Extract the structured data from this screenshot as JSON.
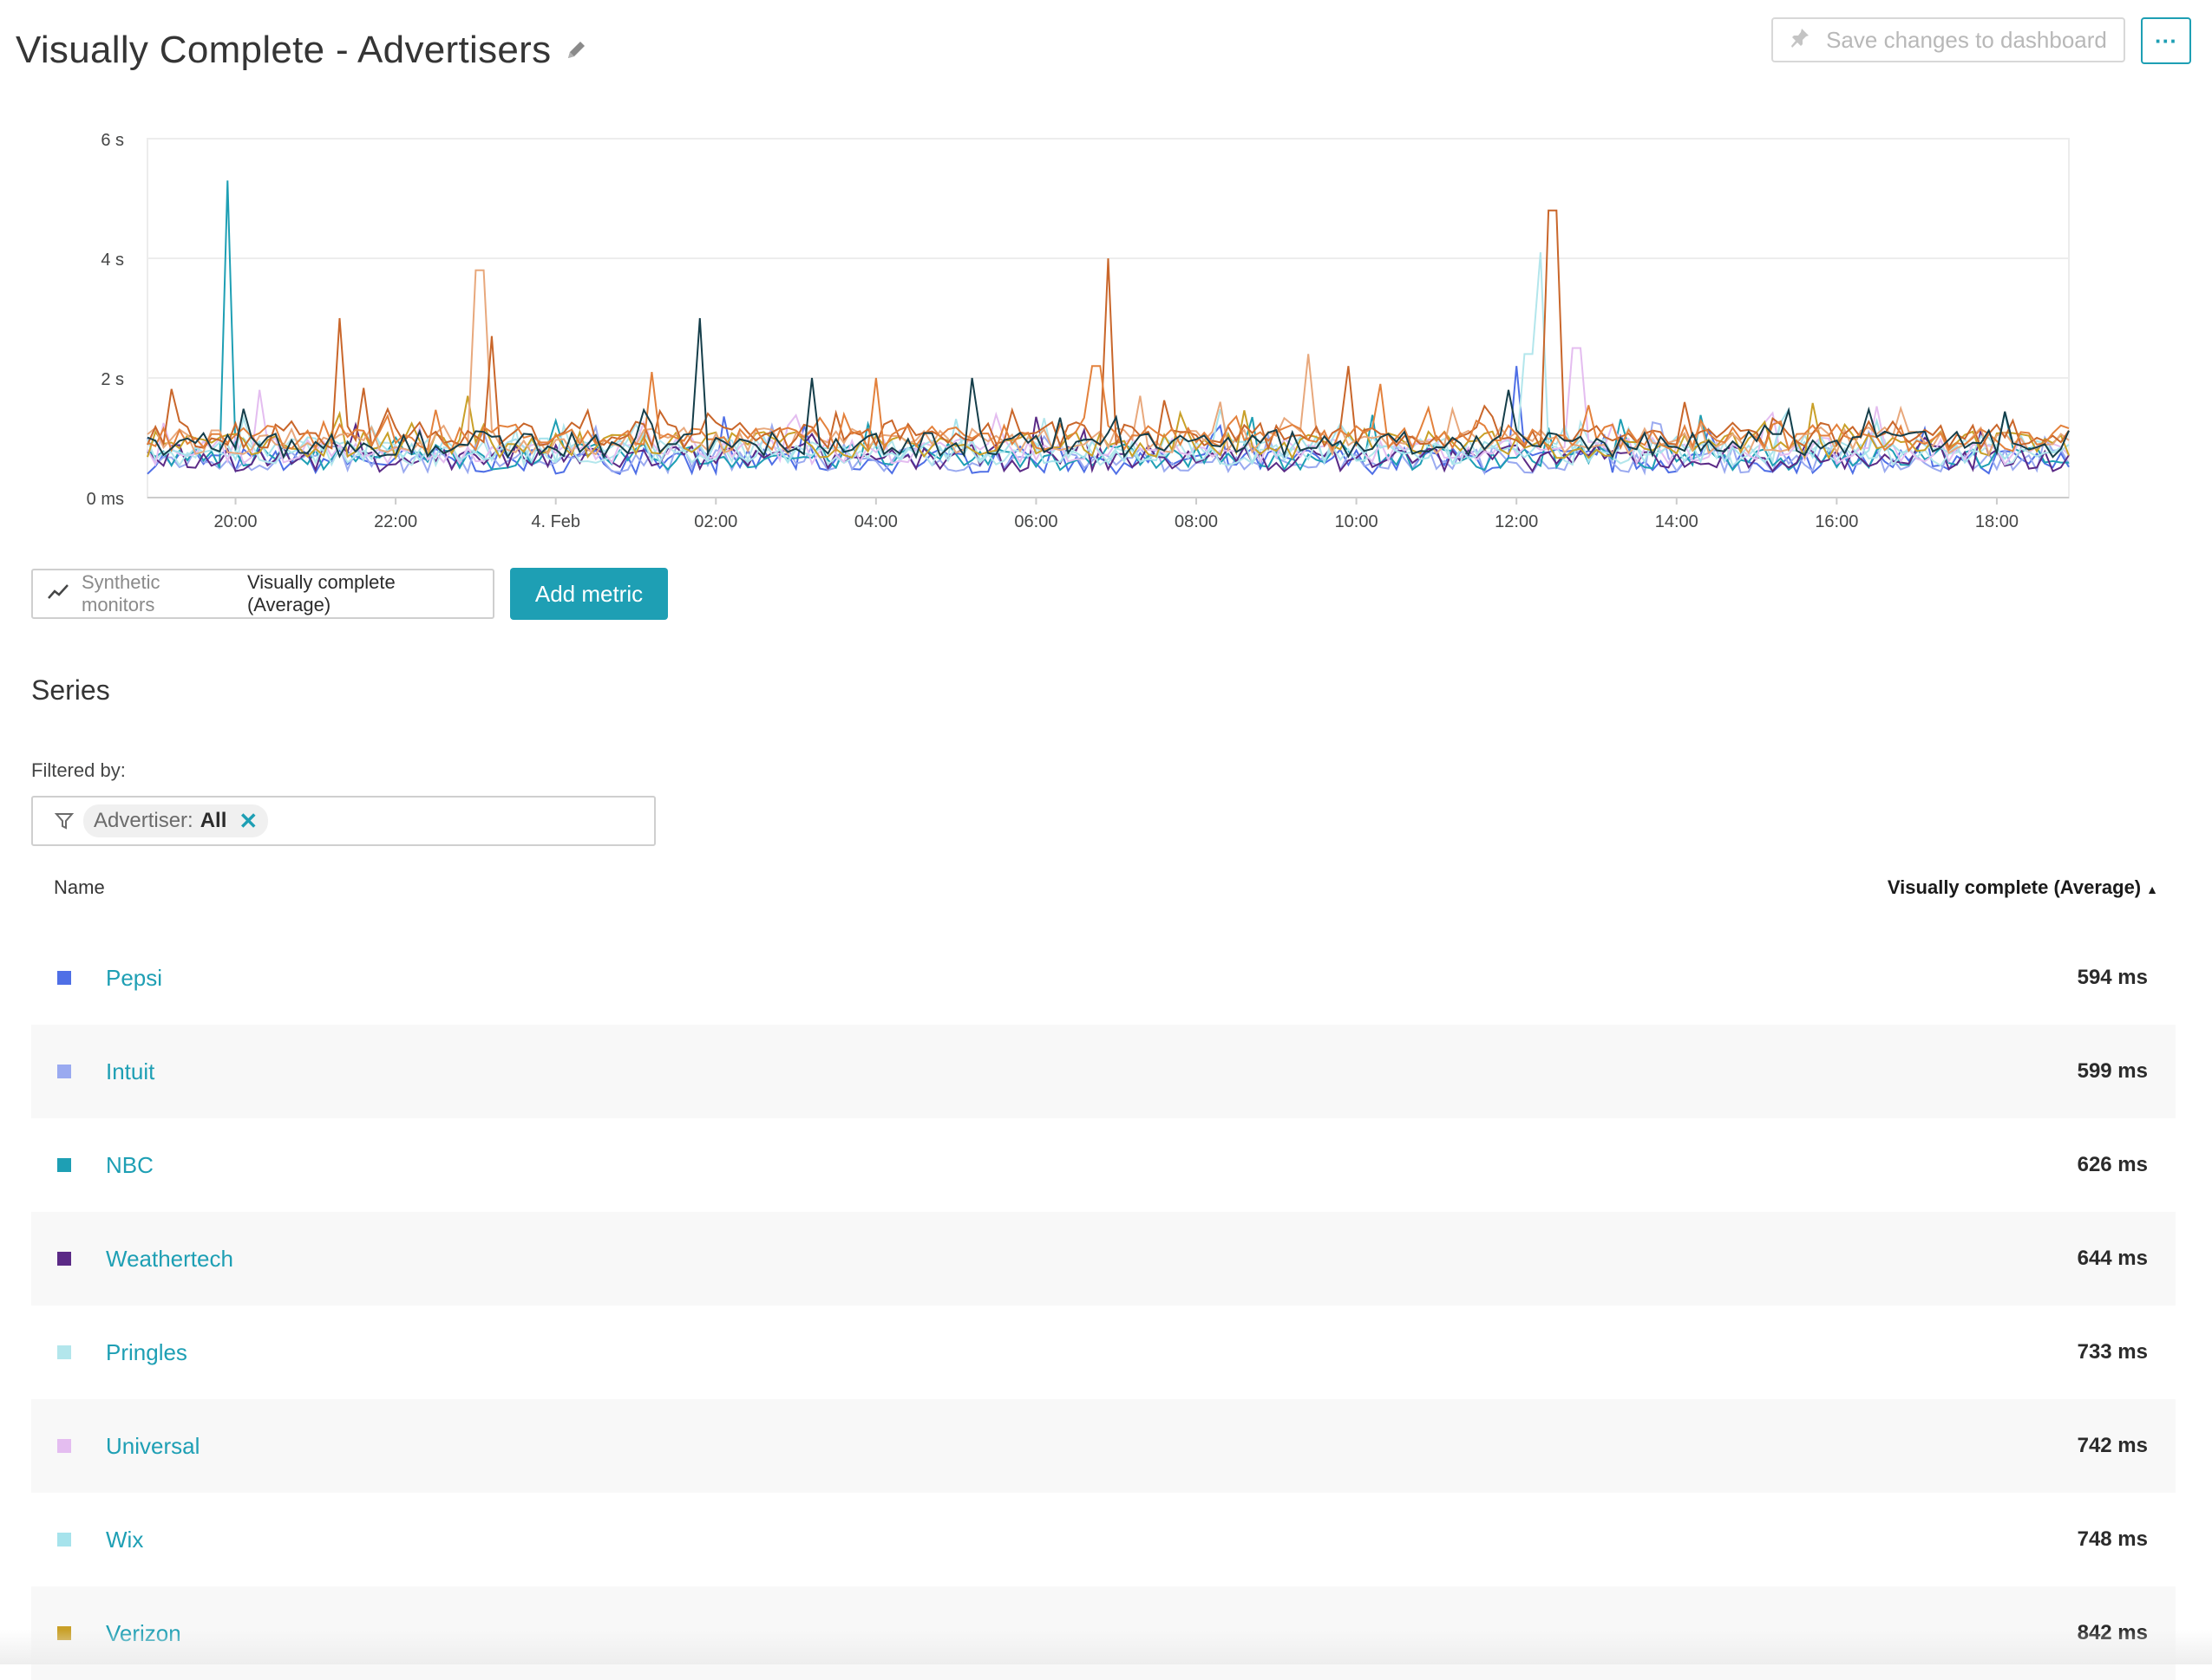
{
  "header": {
    "title": "Visually Complete - Advertisers",
    "save_label": "Save changes to dashboard",
    "more_label": "···"
  },
  "chart_data": {
    "type": "line",
    "title": "",
    "xlabel": "",
    "ylabel": "",
    "y_ticks": [
      "0 ms",
      "2 s",
      "4 s",
      "6 s"
    ],
    "ylim_seconds": [
      0,
      6
    ],
    "x_ticks": [
      "20:00",
      "22:00",
      "4. Feb",
      "02:00",
      "04:00",
      "06:00",
      "08:00",
      "10:00",
      "12:00",
      "14:00",
      "16:00",
      "18:00"
    ],
    "x_range_hours": [
      18.9,
      42.9
    ],
    "grid": true,
    "series": [
      {
        "name": "Pepsi",
        "color": "#4f6fe6",
        "base": 0.62,
        "spikes": [
          [
            17.12,
            2.2
          ]
        ]
      },
      {
        "name": "Intuit",
        "color": "#9aaaf0",
        "base": 0.64,
        "spikes": []
      },
      {
        "name": "NBC",
        "color": "#1e9fb4",
        "base": 0.68,
        "spikes": [
          [
            1.0,
            5.3
          ]
        ]
      },
      {
        "name": "Weathertech",
        "color": "#5b2a86",
        "base": 0.66,
        "spikes": []
      },
      {
        "name": "Pringles",
        "color": "#b3e6ec",
        "base": 0.76,
        "spikes": [
          [
            17.35,
            4.1
          ],
          [
            17.25,
            2.4
          ]
        ]
      },
      {
        "name": "Universal",
        "color": "#e4bdf0",
        "base": 0.78,
        "spikes": [
          [
            1.4,
            1.8
          ],
          [
            17.85,
            2.5
          ]
        ]
      },
      {
        "name": "Wix",
        "color": "#a6e3ec",
        "base": 0.8,
        "spikes": []
      },
      {
        "name": "Verizon",
        "color": "#c9a028",
        "base": 0.88,
        "spikes": [
          [
            4.0,
            1.7
          ]
        ]
      },
      {
        "name": "",
        "color": "#e8a87c",
        "base": 0.95,
        "spikes": [
          [
            4.15,
            3.8
          ],
          [
            13.4,
            1.6
          ],
          [
            14.5,
            2.4
          ]
        ]
      },
      {
        "name": "",
        "color": "#c9662a",
        "base": 1.05,
        "spikes": [
          [
            2.4,
            3.0
          ],
          [
            4.3,
            2.7
          ],
          [
            12.0,
            4.0
          ],
          [
            17.55,
            4.8
          ],
          [
            15.0,
            2.2
          ]
        ]
      },
      {
        "name": "",
        "color": "#e3813c",
        "base": 1.0,
        "spikes": [
          [
            6.3,
            2.1
          ],
          [
            9.1,
            2.0
          ],
          [
            11.85,
            2.2
          ],
          [
            15.4,
            1.9
          ]
        ]
      },
      {
        "name": "",
        "color": "#153e4a",
        "base": 0.9,
        "spikes": [
          [
            6.9,
            3.0
          ],
          [
            8.3,
            2.0
          ],
          [
            10.3,
            2.0
          ],
          [
            17.0,
            1.8
          ]
        ]
      }
    ]
  },
  "metric": {
    "source": "Synthetic monitors",
    "name": "Visually complete (Average)",
    "add_label": "Add metric"
  },
  "series_section": {
    "heading": "Series",
    "filter_label": "Filtered by:",
    "filter_key": "Advertiser:",
    "filter_value": "All",
    "filter_close": "✕"
  },
  "table": {
    "col_name": "Name",
    "col_value": "Visually complete (Average)",
    "sort_arrow": "▲",
    "rows": [
      {
        "name": "Pepsi",
        "value": "594 ms",
        "color": "#4f6fe6"
      },
      {
        "name": "Intuit",
        "value": "599 ms",
        "color": "#9aaaf0"
      },
      {
        "name": "NBC",
        "value": "626 ms",
        "color": "#1e9fb4"
      },
      {
        "name": "Weathertech",
        "value": "644 ms",
        "color": "#5b2a86"
      },
      {
        "name": "Pringles",
        "value": "733 ms",
        "color": "#b3e6ec"
      },
      {
        "name": "Universal",
        "value": "742 ms",
        "color": "#e4bdf0"
      },
      {
        "name": "Wix",
        "value": "748 ms",
        "color": "#a6e3ec"
      },
      {
        "name": "Verizon",
        "value": "842 ms",
        "color": "#c9a028"
      }
    ]
  }
}
